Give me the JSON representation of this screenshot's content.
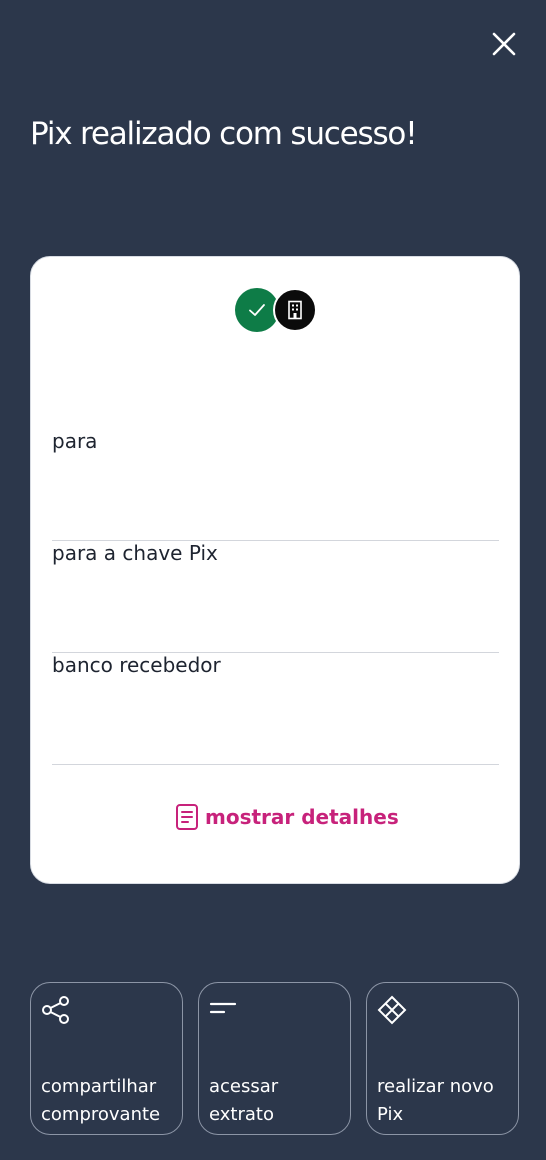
{
  "header": {
    "close_icon": "close-icon",
    "title": "Pix realizado com sucesso!"
  },
  "card": {
    "status_icons": [
      "check-icon",
      "building-icon"
    ],
    "fields": [
      {
        "label": "para",
        "value": ""
      },
      {
        "label": "para a chave Pix",
        "value": ""
      },
      {
        "label": "banco recebedor",
        "value": ""
      }
    ],
    "details_button": {
      "label": "mostrar detalhes",
      "icon": "document-icon"
    }
  },
  "actions": [
    {
      "label": "compartilhar\ncomprovante",
      "icon": "share-icon"
    },
    {
      "label": "acessar\nextrato",
      "icon": "statement-icon"
    },
    {
      "label": "realizar novo\nPix",
      "icon": "pix-icon"
    }
  ],
  "colors": {
    "background": "#2c374b",
    "success_green": "#0e7c47",
    "accent_pink": "#c7227b"
  }
}
